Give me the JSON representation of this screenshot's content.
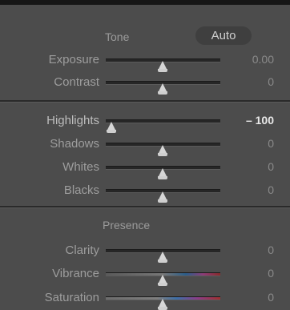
{
  "tone": {
    "title": "Tone",
    "auto_label": "Auto",
    "rows": [
      {
        "label": "Exposure",
        "value": "0.00",
        "level": 0.5
      },
      {
        "label": "Contrast",
        "value": "0",
        "level": 0.5
      }
    ]
  },
  "tone2": {
    "rows": [
      {
        "label": "Highlights",
        "value": "– 100",
        "level": 0.05
      },
      {
        "label": "Shadows",
        "value": "0",
        "level": 0.5
      },
      {
        "label": "Whites",
        "value": "0",
        "level": 0.5
      },
      {
        "label": "Blacks",
        "value": "0",
        "level": 0.5
      }
    ]
  },
  "presence": {
    "title": "Presence",
    "rows": [
      {
        "label": "Clarity",
        "value": "0",
        "level": 0.5
      },
      {
        "label": "Vibrance",
        "value": "0",
        "level": 0.5
      },
      {
        "label": "Saturation",
        "value": "0",
        "level": 0.5
      }
    ]
  },
  "colors": {
    "panel_bg": "#4c4c4c",
    "label": "#9d9d9d",
    "value_active": "#e8e8e8"
  }
}
